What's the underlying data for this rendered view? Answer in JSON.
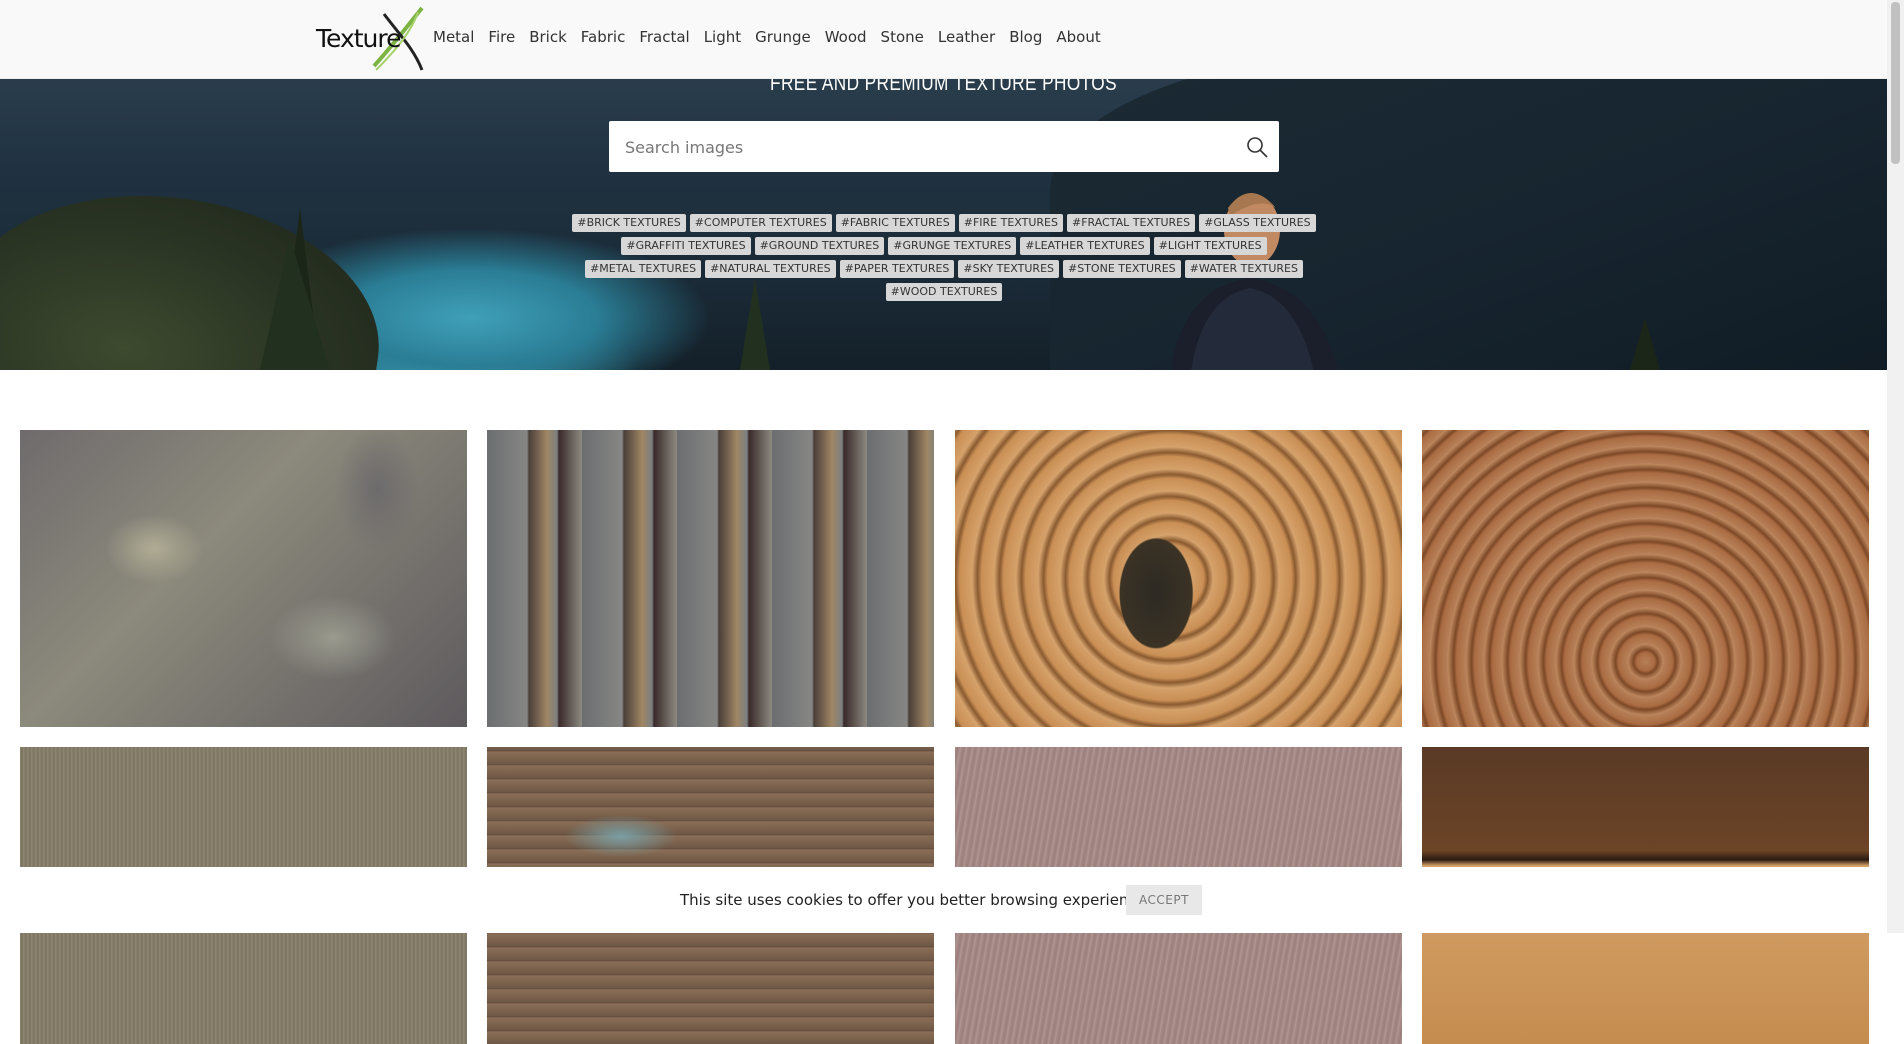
{
  "header": {
    "logo_text": "Texture",
    "logo_letter": "X",
    "nav": [
      "Metal",
      "Fire",
      "Brick",
      "Fabric",
      "Fractal",
      "Light",
      "Grunge",
      "Wood",
      "Stone",
      "Leather",
      "Blog",
      "About"
    ]
  },
  "hero": {
    "title": "FREE AND PREMIUM TEXTURE PHOTOS",
    "search_placeholder": "Search images",
    "tags": [
      "#BRICK TEXTURES",
      "#COMPUTER TEXTURES",
      "#FABRIC TEXTURES",
      "#FIRE TEXTURES",
      "#FRACTAL TEXTURES",
      "#GLASS TEXTURES",
      "#GRAFFITI TEXTURES",
      "#GROUND TEXTURES",
      "#GRUNGE TEXTURES",
      "#LEATHER TEXTURES",
      "#LIGHT TEXTURES",
      "#METAL TEXTURES",
      "#NATURAL TEXTURES",
      "#PAPER TEXTURES",
      "#SKY TEXTURES",
      "#STONE TEXTURES",
      "#WATER TEXTURES",
      "#WOOD TEXTURES"
    ]
  },
  "gallery": [
    {
      "name": "bark-texture-thumb",
      "style": "bark"
    },
    {
      "name": "wood-planks-texture-thumb",
      "style": "planks"
    },
    {
      "name": "cracked-log-texture-thumb",
      "style": "log-crack"
    },
    {
      "name": "tree-rings-texture-thumb",
      "style": "rings"
    },
    {
      "name": "brushed-metal-texture-thumb",
      "style": "metal"
    },
    {
      "name": "painted-wood-texture-thumb",
      "style": "painted-wood"
    },
    {
      "name": "copper-metal-texture-thumb",
      "style": "copper"
    },
    {
      "name": "wood-beams-texture-thumb",
      "style": "beams"
    }
  ],
  "cookie": {
    "text": "This site uses cookies to offer you better browsing experience.",
    "accept": "ACCEPT"
  },
  "colors": {
    "topbar_bg": "#f9f9f9",
    "logo_green": "#7cb342",
    "tag_bg": "#d7d7d7"
  }
}
